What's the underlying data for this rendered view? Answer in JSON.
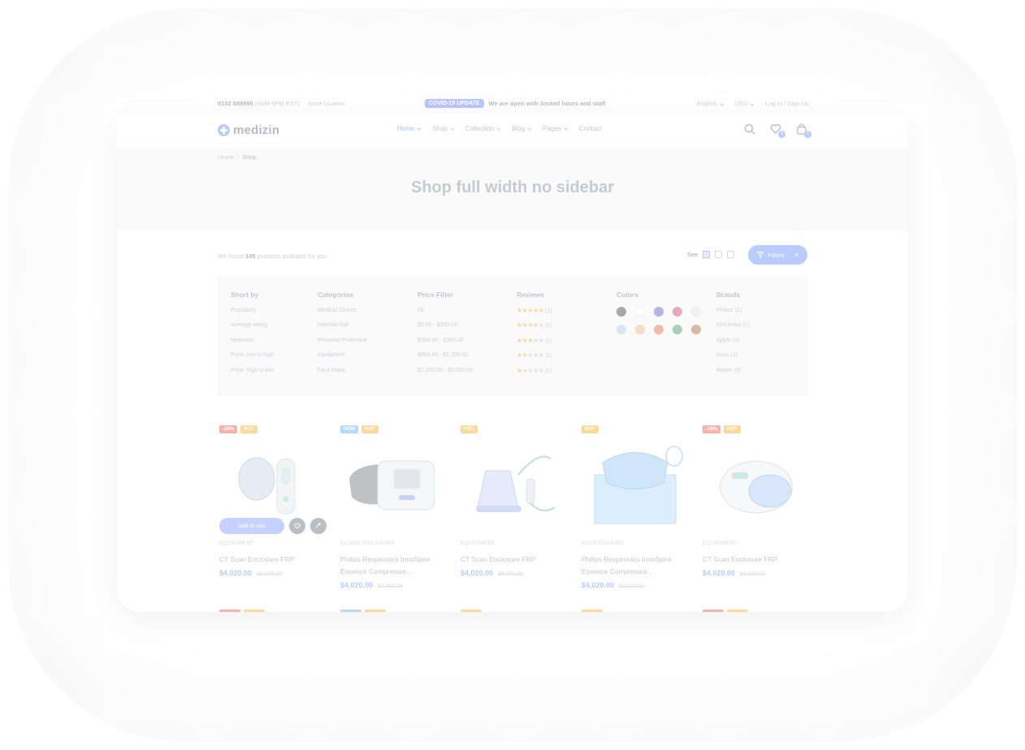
{
  "topbar": {
    "phone": "0102 888990",
    "hours": "(9AM-9PM EST)",
    "location": "Store location",
    "covid_badge": "COVID-19 UPDATE",
    "covid_message": "We are open with limited hours and staff",
    "language": "English",
    "currency": "USD",
    "login": "Log In",
    "signup": "Sign Up"
  },
  "header": {
    "logo": "medizin",
    "nav": [
      {
        "label": "Home",
        "active": true
      },
      {
        "label": "Shop",
        "active": false
      },
      {
        "label": "Collection",
        "active": false
      },
      {
        "label": "Blog",
        "active": false
      },
      {
        "label": "Pages",
        "active": false
      },
      {
        "label": "Contact",
        "active": false
      }
    ],
    "wishlist_count": "0",
    "cart_count": "0"
  },
  "breadcrumb": {
    "home": "Home",
    "sep": "/",
    "current": "Shop"
  },
  "hero": {
    "title": "Shop full width no sidebar"
  },
  "toolbar": {
    "found_prefix": "We found",
    "found_count": "145",
    "found_suffix": "products available for you",
    "see_label": "See",
    "filters_label": "Filters"
  },
  "filters": {
    "sort": {
      "title": "Short by",
      "items": [
        "Popularity",
        "Average rating",
        "Newness",
        "Price: low to high",
        "Price: high to low"
      ]
    },
    "categories": {
      "title": "Categories",
      "items": [
        "Medical Gloves",
        "Hazmat Suit",
        "Personal Protective",
        "Equipment",
        "Face Mask"
      ]
    },
    "price": {
      "title": "Price Filter",
      "items": [
        "All",
        "$0.00 - $300.00",
        "$300.00 - $900.00",
        "$900.00 - $1,200.00",
        "$1,200.00 - $5,000.00"
      ]
    },
    "reviews": {
      "title": "Reviews",
      "items": [
        {
          "rating": 5,
          "count": "(1)"
        },
        {
          "rating": 4,
          "count": "(1)"
        },
        {
          "rating": 3,
          "count": "(1)"
        },
        {
          "rating": 2,
          "count": "(1)"
        },
        {
          "rating": 1,
          "count": "(1)"
        }
      ]
    },
    "colors": {
      "title": "Colors",
      "swatches": [
        "#a6a6a6",
        "#ffffff",
        "#b6b1e6",
        "#e8a9bd",
        "#f1f1f1",
        "#d6e6f6",
        "#f7dcc2",
        "#f1baa9",
        "#a6d1b9",
        "#d9b8a8"
      ]
    },
    "brands": {
      "title": "Brands",
      "items": [
        "Philips (2)",
        "Electrolux (1)",
        "Apple (3)",
        "Asus (1)",
        "Baxter (6)"
      ]
    }
  },
  "products": [
    {
      "badges": [
        [
          "sale",
          "-20%"
        ],
        [
          "hot",
          "HOT"
        ]
      ],
      "category": "EQUIPMENT",
      "name": "CT Scan Enclosure FRP",
      "price": "$4,020.00",
      "old_price": "$5,000.00",
      "add_to_cart": "Add to cart",
      "image": "nebulizer-handheld"
    },
    {
      "badges": [
        [
          "new",
          "NEW"
        ],
        [
          "hot",
          "HOT"
        ]
      ],
      "category": "BLOOD PRESSURE",
      "name": "Philips Respironics InnoSpire Essence Compressor...",
      "price": "$4,020.00",
      "old_price": "$5,000.00",
      "image": "bp-monitor"
    },
    {
      "badges": [
        [
          "hot",
          "HOT"
        ]
      ],
      "category": "EQUIPMENT",
      "name": "CT Scan Enclosure FRP",
      "price": "$4,020.00",
      "old_price": "$5,000.00",
      "image": "nebulizer-kit"
    },
    {
      "badges": [
        [
          "hot",
          "HOT"
        ]
      ],
      "category": "ACCESSORIES",
      "name": "Philips Respironics InnoSpire Essence Compressor...",
      "price": "$4,020.00",
      "old_price": "$5,000.00",
      "image": "face-mask-box"
    },
    {
      "badges": [
        [
          "sale",
          "-10%"
        ],
        [
          "hot",
          "HOT"
        ]
      ],
      "category": "EQUIPMENT",
      "name": "CT Scan Enclosure FRP",
      "price": "$4,020.00",
      "old_price": "$5,000.00",
      "image": "compressor"
    }
  ],
  "colors": {
    "accent": "#b9cbff",
    "hot": "#fbd99c",
    "sale": "#f7b2ae",
    "new": "#b5d9f6"
  }
}
